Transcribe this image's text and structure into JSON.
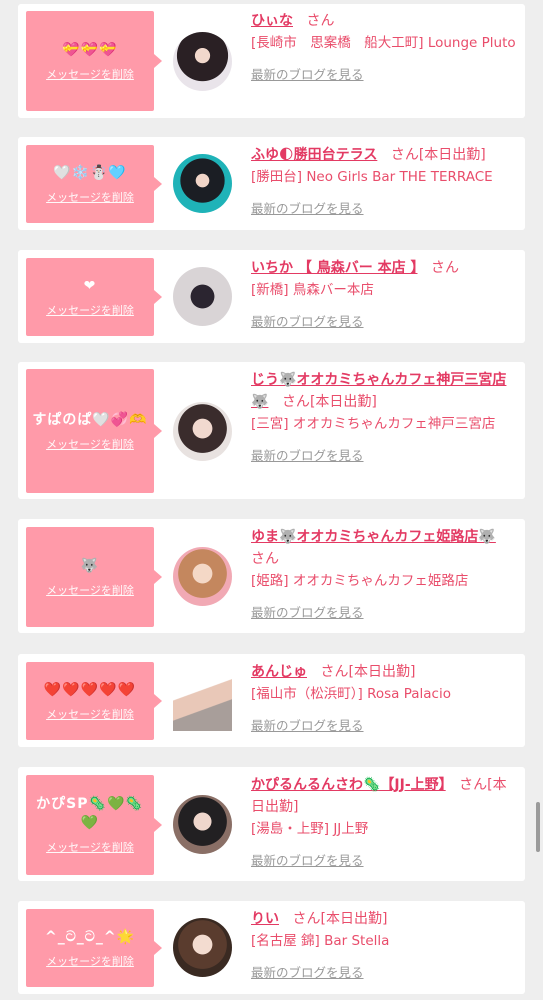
{
  "delete_label": "メッセージを削除",
  "honorific": "さん",
  "blog_label": "最新のブログを見る",
  "colors": {
    "bubble": "#ff9aa9",
    "name": "#e33a63",
    "text": "#e94d6b",
    "link_gray": "#999999"
  },
  "items": [
    {
      "emoji": "💝💝💝",
      "name": "ひぃな",
      "suffix": "",
      "shop": "[長崎市　思案橋　船大工町] Lounge Pluto"
    },
    {
      "emoji": "🤍❄️☃️🩵",
      "name": "ふゆ🌓勝田台テラス",
      "suffix": "[本日出勤]",
      "shop": "[勝田台] Neo Girls Bar THE TERRACE"
    },
    {
      "emoji": "❤",
      "name": "いちか 【 鳥森バー 本店 】",
      "suffix": "",
      "shop": "[新橋] 鳥森バー本店"
    },
    {
      "emoji": "すぱのぱ🤍💞🫶",
      "name": "じう🐺オオカミちゃんカフェ神戸三宮店🐺",
      "suffix": "[本日出勤]",
      "shop": "[三宮] オオカミちゃんカフェ神戸三宮店"
    },
    {
      "emoji": "🐺",
      "name": "ゆま🐺オオカミちゃんカフェ姫路店🐺",
      "suffix": "",
      "shop": "[姫路] オオカミちゃんカフェ姫路店"
    },
    {
      "emoji": "❤️❤️❤️❤️❤️",
      "name": "あんじゅ",
      "suffix": "[本日出勤]",
      "shop": "[福山市（松浜町）] Rosa Palacio"
    },
    {
      "emoji": "かぴSP🦠💚🦠💚",
      "name": "かぴるんるんさわ🦠【JJ-上野】",
      "suffix": "[本日出勤]",
      "shop": "[湯島・上野] JJ上野"
    },
    {
      "emoji": "^_ට_ට_^🌟",
      "name": "りい",
      "suffix": "[本日出勤]",
      "shop": "[名古屋 錦] Bar Stella"
    }
  ]
}
